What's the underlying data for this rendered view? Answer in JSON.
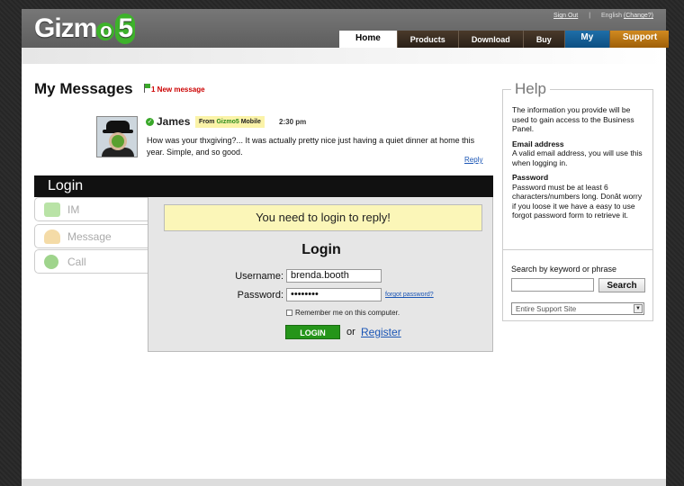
{
  "header": {
    "logo_main": "Gizm",
    "logo_o": "o",
    "logo_five": "5",
    "sign_out": "Sign Out",
    "language": "English",
    "change": "(Change?)",
    "nav": [
      "Home",
      "Products",
      "Download",
      "Buy",
      "My",
      "Support"
    ]
  },
  "messages": {
    "title": "My Messages",
    "new_count": "1 New message",
    "sender": "James",
    "from_prefix": "From ",
    "from_brand": "Gizmo5",
    "from_suffix": " Mobile",
    "time": "2:30 pm",
    "body": "How was your thxgiving?...  It was actually pretty nice just having a quiet dinner at home this year. Simple, and so good.",
    "reply": "Reply"
  },
  "login": {
    "bar_title": "Login",
    "side_tabs": [
      "IM",
      "Message",
      "Call"
    ],
    "notice": "You need to login to reply!",
    "heading": "Login",
    "username_label": "Username:",
    "username_value": "brenda.booth",
    "password_label": "Password:",
    "password_value": "••••••••",
    "forgot": "forgot password?",
    "remember": "Remember me on this computer.",
    "login_button": "LOGIN",
    "or": "or",
    "register": "Register"
  },
  "help": {
    "title": "Help",
    "intro": "The information you provide will be used to gain access to the Business Panel.",
    "email_heading": "Email address",
    "email_text": "A valid email address, you will use this when logging in.",
    "password_heading": "Password",
    "password_text": "Password must be at least 6 characters/numbers long. Donât worry if you loose it we have a easy to use forgot password form to retrieve it.",
    "search_label": "Search by keyword or phrase",
    "search_button": "Search",
    "scope_value": "Entire Support Site"
  },
  "colors": {
    "brand_green": "#3db22a",
    "link_blue": "#1a55b5",
    "alert_red": "#cc0000"
  }
}
